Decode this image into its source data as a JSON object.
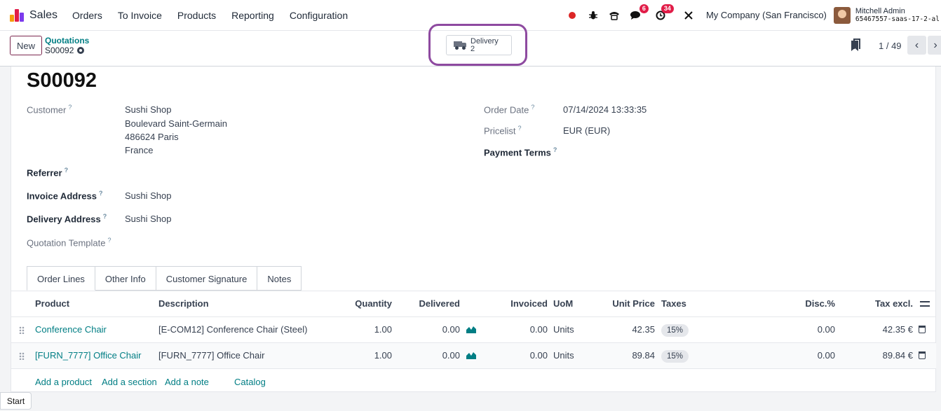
{
  "navbar": {
    "app_name": "Sales",
    "menu": [
      "Orders",
      "To Invoice",
      "Products",
      "Reporting",
      "Configuration"
    ],
    "messages_badge": "6",
    "activities_badge": "34",
    "company": "My Company (San Francisco)",
    "user_name": "Mitchell Admin",
    "database": "65467557-saas-17-2-al",
    "colors": {
      "record": "#dc2626",
      "badge": "#e11d48"
    }
  },
  "control": {
    "new_label": "New",
    "breadcrumb": "Quotations",
    "record": "S00092",
    "smart_button": {
      "label": "Delivery",
      "count": "2",
      "icon": "truck-icon"
    },
    "pager": "1 / 49"
  },
  "form": {
    "name": "S00092",
    "customer_label": "Customer",
    "customer_name": "Sushi Shop",
    "customer_address": [
      "Boulevard Saint-Germain",
      "486624 Paris",
      "France"
    ],
    "referrer_label": "Referrer",
    "invoice_address_label": "Invoice Address",
    "invoice_address": "Sushi Shop",
    "delivery_address_label": "Delivery Address",
    "delivery_address": "Sushi Shop",
    "template_label": "Quotation Template",
    "order_date_label": "Order Date",
    "order_date": "07/14/2024 13:33:35",
    "pricelist_label": "Pricelist",
    "pricelist": "EUR (EUR)",
    "payment_terms_label": "Payment Terms",
    "help_mark": "?"
  },
  "tabs": [
    "Order Lines",
    "Other Info",
    "Customer Signature",
    "Notes"
  ],
  "table": {
    "headers": {
      "product": "Product",
      "description": "Description",
      "quantity": "Quantity",
      "delivered": "Delivered",
      "invoiced": "Invoiced",
      "uom": "UoM",
      "unit_price": "Unit Price",
      "taxes": "Taxes",
      "discount": "Disc.%",
      "subtotal": "Tax excl."
    },
    "rows": [
      {
        "product": "Conference Chair",
        "description": "[E-COM12] Conference Chair (Steel)",
        "quantity": "1.00",
        "delivered": "0.00",
        "invoiced": "0.00",
        "uom": "Units",
        "unit_price": "42.35",
        "tax": "15%",
        "discount": "0.00",
        "subtotal": "42.35 €"
      },
      {
        "product": "[FURN_7777] Office Chair",
        "description": "[FURN_7777] Office Chair",
        "quantity": "1.00",
        "delivered": "0.00",
        "invoiced": "0.00",
        "uom": "Units",
        "unit_price": "89.84",
        "tax": "15%",
        "discount": "0.00",
        "subtotal": "89.84 €"
      }
    ],
    "actions": {
      "add_product": "Add a product",
      "add_section": "Add a section",
      "add_note": "Add a note",
      "catalog": "Catalog"
    }
  },
  "taskbar": {
    "start": "Start"
  }
}
